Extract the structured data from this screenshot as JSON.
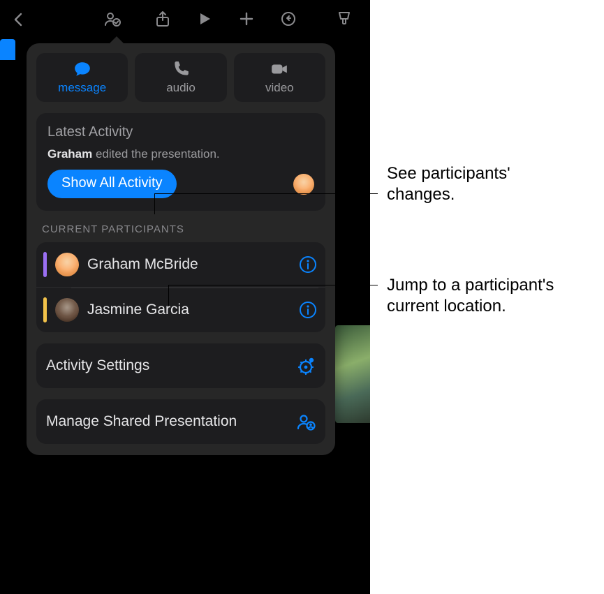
{
  "toolbar": {
    "icons": [
      "back",
      "collaborate",
      "share",
      "play",
      "add",
      "undo",
      "format-brush"
    ]
  },
  "popover": {
    "segments": {
      "message": "message",
      "audio": "audio",
      "video": "video",
      "active": "message"
    },
    "latest": {
      "title": "Latest Activity",
      "actor": "Graham",
      "rest": " edited the presentation.",
      "show_all": "Show All Activity"
    },
    "participants_header": "CURRENT PARTICIPANTS",
    "participants": [
      {
        "name": "Graham McBride",
        "color": "purple"
      },
      {
        "name": "Jasmine Garcia",
        "color": "yellow"
      }
    ],
    "activity_settings": "Activity Settings",
    "manage_shared": "Manage Shared Presentation"
  },
  "callouts": {
    "changes": "See participants' changes.",
    "jump": "Jump to a participant's current location."
  }
}
